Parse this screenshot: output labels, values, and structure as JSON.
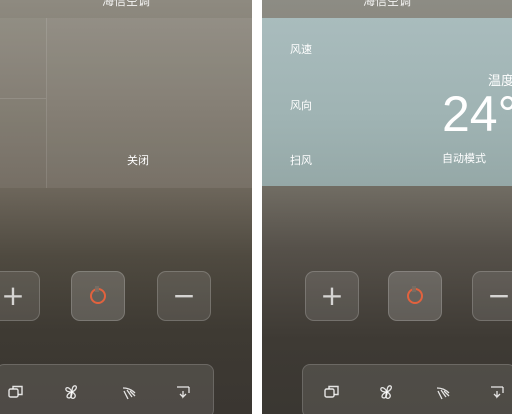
{
  "app": {
    "title": "海信空调"
  },
  "left_screen": {
    "status_text": "关闭"
  },
  "right_screen": {
    "info": {
      "fan_speed_label": "风速",
      "wind_direction_label": "风向",
      "swing_label": "扫风",
      "temperature_label": "温度",
      "temperature_value": "24°",
      "mode_text": "自动模式"
    }
  },
  "controls": {
    "increase_glyph": "+",
    "decrease_glyph": "−"
  },
  "mode_bar": {
    "icons": [
      "mode-icon",
      "fan-icon",
      "swing-icon",
      "direction-icon"
    ]
  },
  "colors": {
    "power_accent": "#e2623e",
    "info_panel": "#a9bcbd"
  }
}
